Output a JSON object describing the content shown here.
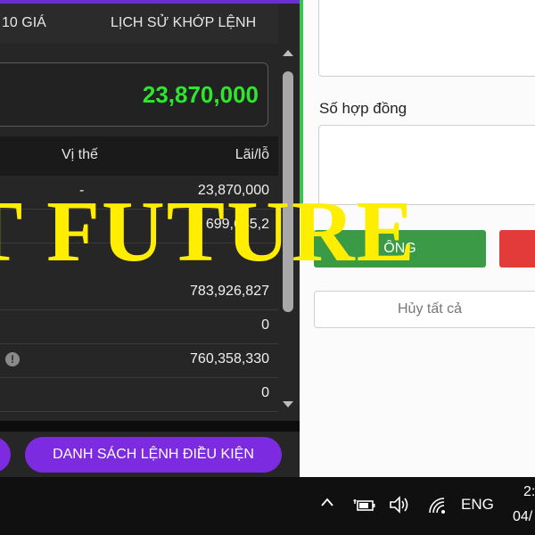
{
  "tabs": {
    "left_label": "10 GIÁ",
    "right_label": "LỊCH SỬ KHỚP LỆNH"
  },
  "balance": {
    "value": "23,870,000",
    "color": "#2ee62e"
  },
  "table": {
    "headers": {
      "position": "Vị thế",
      "pnl": "Lãi/lỗ"
    },
    "rows": [
      {
        "position": "-",
        "pnl": "23,870,000",
        "info": false
      },
      {
        "position": "",
        "pnl": "699,645,2",
        "info": false
      },
      {
        "position": "",
        "pnl": "783,926,827",
        "info": false
      },
      {
        "position": "",
        "pnl": "0",
        "info": false
      },
      {
        "position": "",
        "pnl": "760,358,330",
        "info": true
      },
      {
        "position": "",
        "pnl": "0",
        "info": false
      }
    ]
  },
  "buttons": {
    "conditional_orders": "DANH SÁCH LỆNH ĐIỀU KIỆN",
    "buy_partial": "ÔNG",
    "cancel_all": "Hủy tất cả"
  },
  "form": {
    "contracts_label": "Số hợp đồng"
  },
  "watermark": {
    "text": "T FUTURE"
  },
  "taskbar": {
    "language": "ENG",
    "time_partial": "2:",
    "date_partial": "04/"
  },
  "colors": {
    "accent_purple": "#7c2be0",
    "buy_green": "#3a9a45",
    "sell_red": "#e33a3a",
    "watermark_yellow": "#ffee00"
  }
}
